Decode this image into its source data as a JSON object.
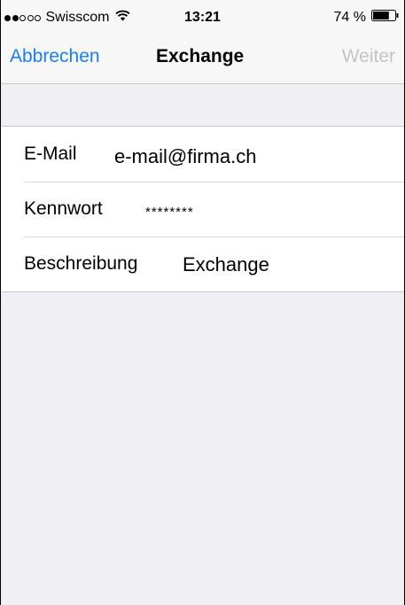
{
  "status_bar": {
    "carrier": "Swisscom",
    "time": "13:21",
    "battery": "74 %",
    "battery_level": 0.74,
    "signal_bars_filled": 2,
    "signal_bars_total": 5,
    "icons": [
      "signal-icon",
      "wifi-icon",
      "battery-icon"
    ]
  },
  "nav": {
    "cancel_label": "Abbrechen",
    "title": "Exchange",
    "next_label": "Weiter"
  },
  "form": {
    "email": {
      "label": "E-Mail",
      "value": "e-mail@firma.ch"
    },
    "password": {
      "label": "Kennwort",
      "value": "********"
    },
    "description": {
      "label": "Beschreibung",
      "value": "Exchange"
    }
  },
  "colors": {
    "accent": "#1a7cf9",
    "disabled": "#c4c4c8",
    "background": "#efeff4"
  }
}
